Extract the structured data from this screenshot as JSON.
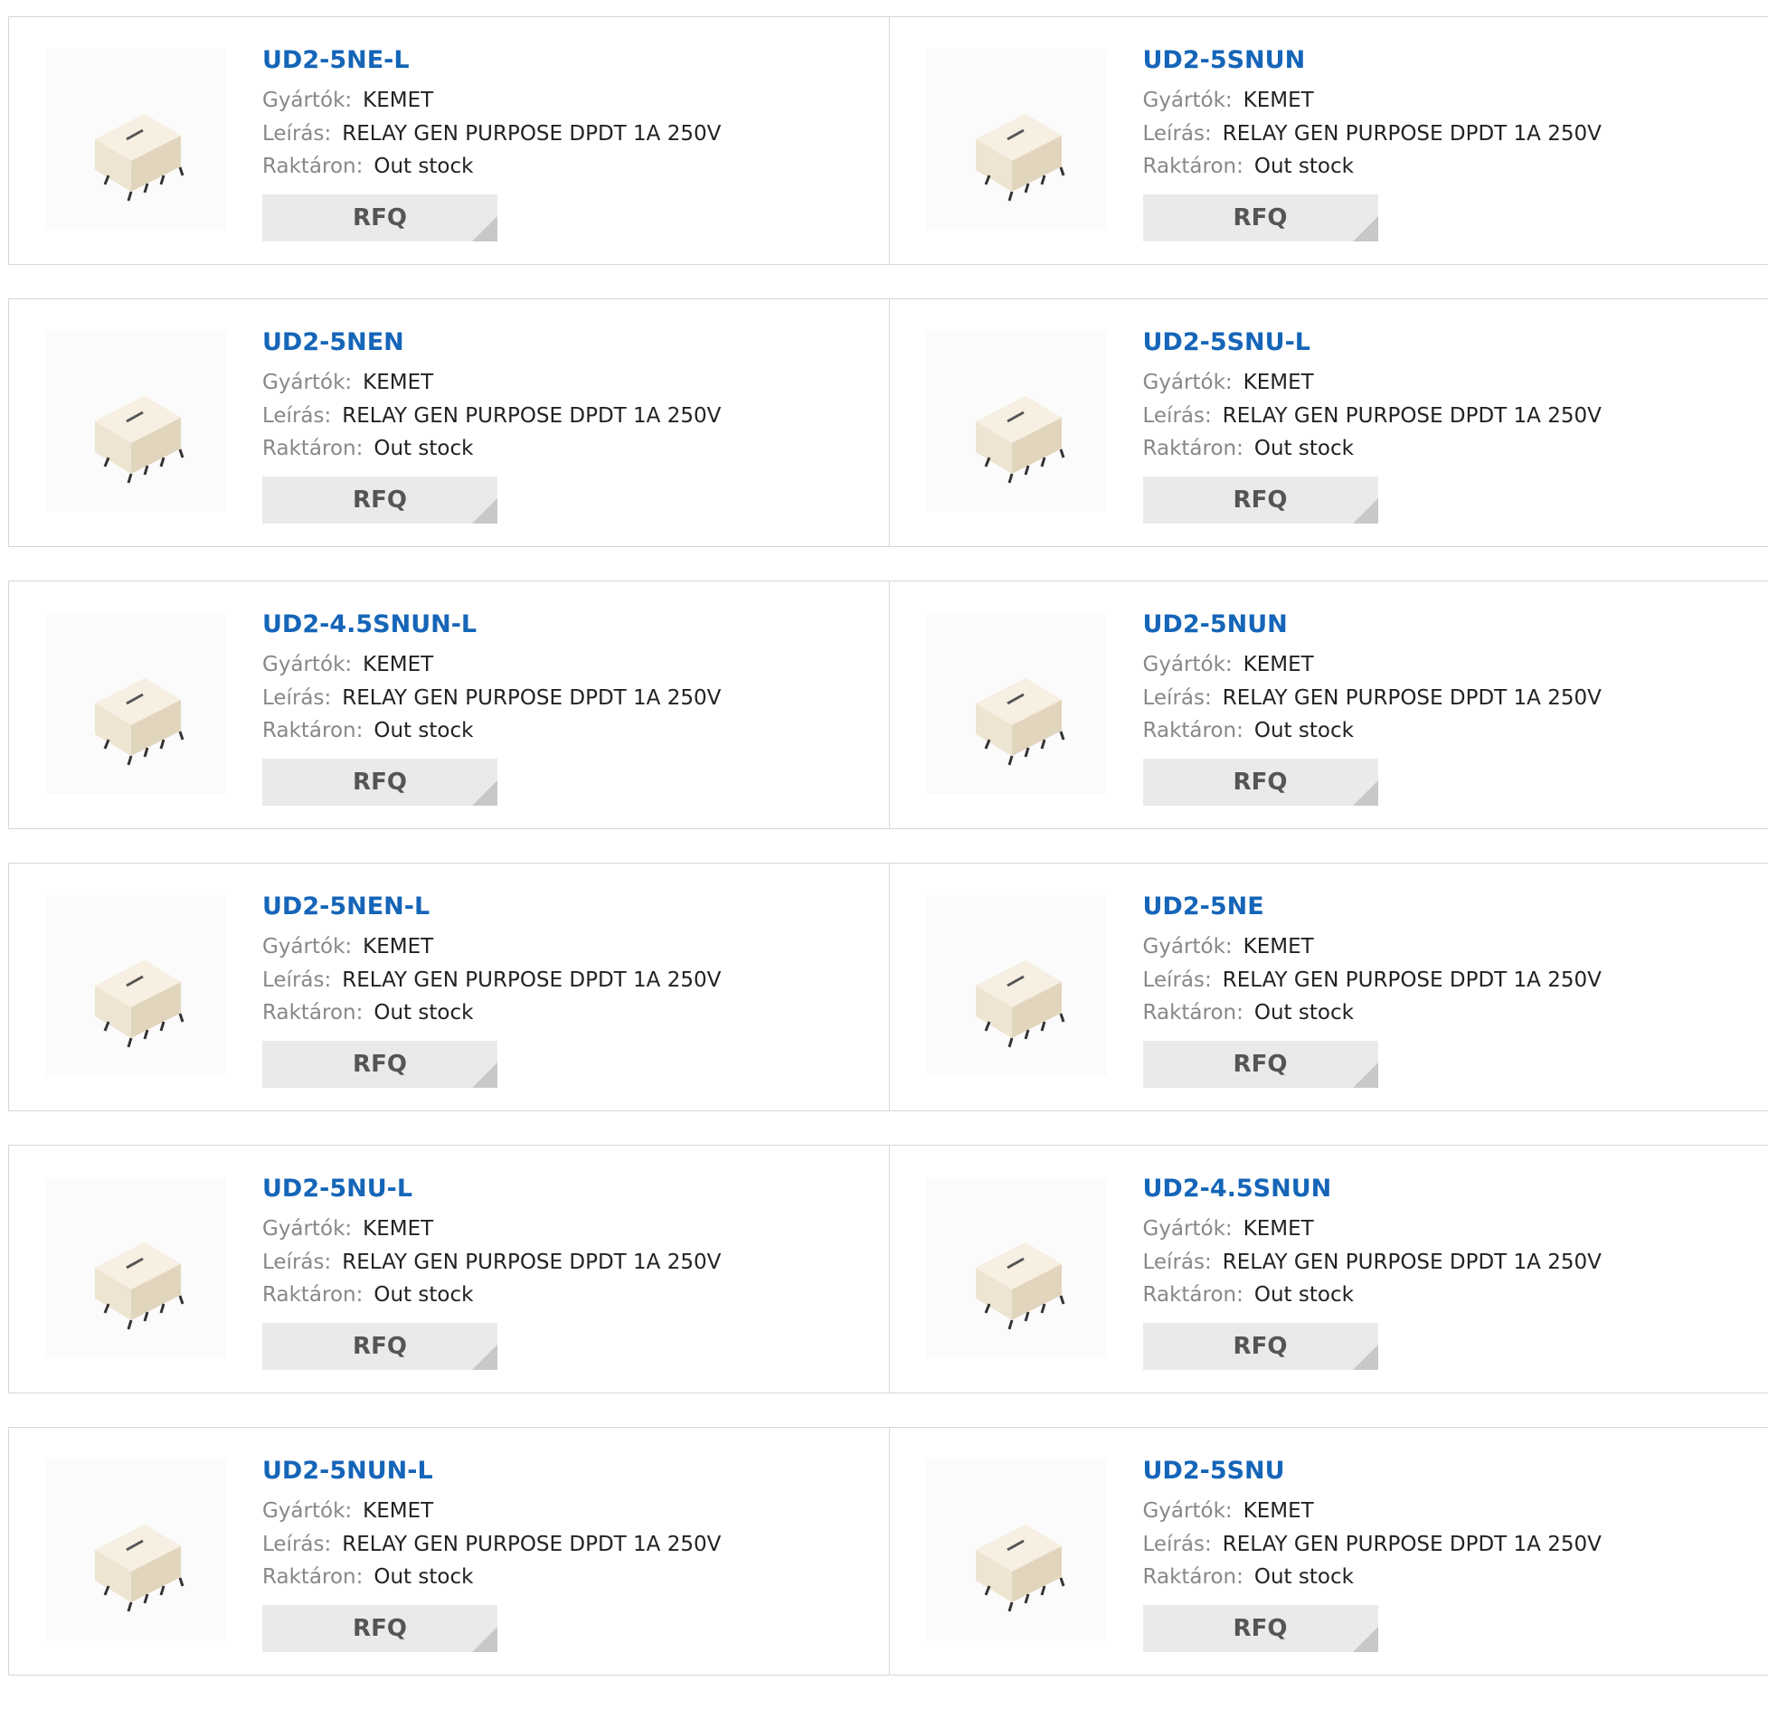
{
  "labels": {
    "manufacturer": "Gyártók:",
    "description": "Leírás:",
    "stock": "Raktáron:",
    "rfq": "RFQ"
  },
  "products": [
    {
      "part": "UD2-5NE-L",
      "manufacturer": "KEMET",
      "description": "RELAY GEN PURPOSE DPDT 1A 250V",
      "stock": "Out stock"
    },
    {
      "part": "UD2-5SNUN",
      "manufacturer": "KEMET",
      "description": "RELAY GEN PURPOSE DPDT 1A 250V",
      "stock": "Out stock"
    },
    {
      "part": "UD2-5NEN",
      "manufacturer": "KEMET",
      "description": "RELAY GEN PURPOSE DPDT 1A 250V",
      "stock": "Out stock"
    },
    {
      "part": "UD2-5SNU-L",
      "manufacturer": "KEMET",
      "description": "RELAY GEN PURPOSE DPDT 1A 250V",
      "stock": "Out stock"
    },
    {
      "part": "UD2-4.5SNUN-L",
      "manufacturer": "KEMET",
      "description": "RELAY GEN PURPOSE DPDT 1A 250V",
      "stock": "Out stock"
    },
    {
      "part": "UD2-5NUN",
      "manufacturer": "KEMET",
      "description": "RELAY GEN PURPOSE DPDT 1A 250V",
      "stock": "Out stock"
    },
    {
      "part": "UD2-5NEN-L",
      "manufacturer": "KEMET",
      "description": "RELAY GEN PURPOSE DPDT 1A 250V",
      "stock": "Out stock"
    },
    {
      "part": "UD2-5NE",
      "manufacturer": "KEMET",
      "description": "RELAY GEN PURPOSE DPDT 1A 250V",
      "stock": "Out stock"
    },
    {
      "part": "UD2-5NU-L",
      "manufacturer": "KEMET",
      "description": "RELAY GEN PURPOSE DPDT 1A 250V",
      "stock": "Out stock"
    },
    {
      "part": "UD2-4.5SNUN",
      "manufacturer": "KEMET",
      "description": "RELAY GEN PURPOSE DPDT 1A 250V",
      "stock": "Out stock"
    },
    {
      "part": "UD2-5NUN-L",
      "manufacturer": "KEMET",
      "description": "RELAY GEN PURPOSE DPDT 1A 250V",
      "stock": "Out stock"
    },
    {
      "part": "UD2-5SNU",
      "manufacturer": "KEMET",
      "description": "RELAY GEN PURPOSE DPDT 1A 250V",
      "stock": "Out stock"
    }
  ],
  "colors": {
    "part_link": "#1565b8",
    "label": "#888888",
    "border": "#d6d6d6",
    "rfq_bg": "#eaeaea"
  }
}
